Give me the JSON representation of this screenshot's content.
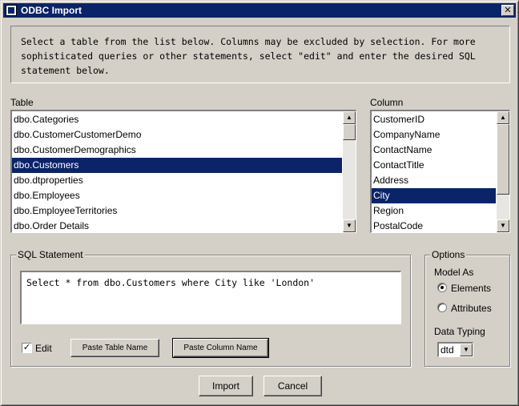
{
  "window": {
    "title": "ODBC Import",
    "close_glyph": "✕"
  },
  "instructions": "Select a table from the list below. Columns may be excluded by selection. For more\nsophisticated queries or other statements, select \"edit\" and enter the desired SQL\nstatement below.",
  "table_list": {
    "label": "Table",
    "items": [
      "dbo.Categories",
      "dbo.CustomerCustomerDemo",
      "dbo.CustomerDemographics",
      "dbo.Customers",
      "dbo.dtproperties",
      "dbo.Employees",
      "dbo.EmployeeTerritories",
      "dbo.Order Details"
    ],
    "selected_index": 3
  },
  "column_list": {
    "label": "Column",
    "items": [
      "CustomerID",
      "CompanyName",
      "ContactName",
      "ContactTitle",
      "Address",
      "City",
      "Region",
      "PostalCode"
    ],
    "selected_index": 5
  },
  "sql": {
    "legend": "SQL Statement",
    "statement": "Select * from dbo.Customers where City like 'London'",
    "edit_label": "Edit",
    "edit_checked": true,
    "paste_table_label": "Paste Table Name",
    "paste_column_label": "Paste Column Name"
  },
  "options": {
    "legend": "Options",
    "model_as_label": "Model As",
    "elements_label": "Elements",
    "attributes_label": "Attributes",
    "model_as_selected": "Elements",
    "data_typing_label": "Data Typing",
    "data_typing_value": "dtd"
  },
  "footer": {
    "import_label": "Import",
    "cancel_label": "Cancel"
  },
  "icons": {
    "scroll_up": "▲",
    "scroll_down": "▼",
    "check": "✓"
  }
}
